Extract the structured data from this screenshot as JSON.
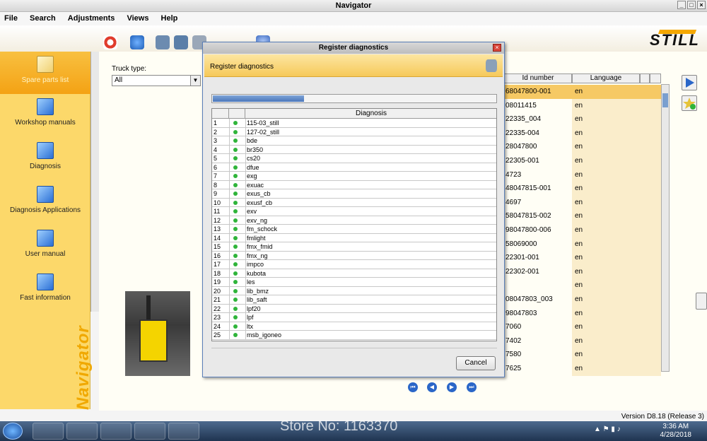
{
  "window": {
    "title": "Navigator"
  },
  "menu": [
    "File",
    "Search",
    "Adjustments",
    "Views",
    "Help"
  ],
  "logo": "STILL",
  "sidebar": {
    "items": [
      {
        "label": "Spare parts list",
        "icon": "book-icon",
        "active": true
      },
      {
        "label": "Workshop manuals",
        "icon": "book-icon",
        "active": false
      },
      {
        "label": "Diagnosis",
        "icon": "book-icon",
        "active": false
      },
      {
        "label": "Diagnosis Applications",
        "icon": "book-icon",
        "active": false
      },
      {
        "label": "User manual",
        "icon": "book-icon",
        "active": false
      },
      {
        "label": "Fast information",
        "icon": "book-icon",
        "active": false
      }
    ],
    "watermark": "Navigator"
  },
  "filter": {
    "truck_type_label": "Truck type:",
    "truck_type_value": "All"
  },
  "right_grid": {
    "columns": [
      "Id number",
      "Language"
    ],
    "rows": [
      {
        "id": "68047800-001",
        "lang": "en"
      },
      {
        "id": "08011415",
        "lang": "en"
      },
      {
        "id": "22335_004",
        "lang": "en"
      },
      {
        "id": "22335-004",
        "lang": "en"
      },
      {
        "id": "28047800",
        "lang": "en"
      },
      {
        "id": "22305-001",
        "lang": "en"
      },
      {
        "id": "4723",
        "lang": "en"
      },
      {
        "id": "48047815-001",
        "lang": "en"
      },
      {
        "id": "4697",
        "lang": "en"
      },
      {
        "id": "58047815-002",
        "lang": "en"
      },
      {
        "id": "98047800-006",
        "lang": "en"
      },
      {
        "id": "58069000",
        "lang": "en"
      },
      {
        "id": "22301-001",
        "lang": "en"
      },
      {
        "id": "22302-001",
        "lang": "en"
      },
      {
        "id": "",
        "lang": "en"
      },
      {
        "id": "08047803_003",
        "lang": "en"
      },
      {
        "id": "98047803",
        "lang": "en"
      },
      {
        "id": "7060",
        "lang": "en"
      },
      {
        "id": "7402",
        "lang": "en"
      },
      {
        "id": "7580",
        "lang": "en"
      },
      {
        "id": "7625",
        "lang": "en"
      }
    ]
  },
  "dialog": {
    "title": "Register diagnostics",
    "banner": "Register diagnostics",
    "progress": 0.32,
    "column": "Diagnosis",
    "rows": [
      {
        "n": "1",
        "name": "115-03_still"
      },
      {
        "n": "2",
        "name": "127-02_still"
      },
      {
        "n": "3",
        "name": "bde"
      },
      {
        "n": "4",
        "name": "br350"
      },
      {
        "n": "5",
        "name": "cs20"
      },
      {
        "n": "6",
        "name": "dfue"
      },
      {
        "n": "7",
        "name": "exg"
      },
      {
        "n": "8",
        "name": "exuac"
      },
      {
        "n": "9",
        "name": "exus_cb"
      },
      {
        "n": "10",
        "name": "exusf_cb"
      },
      {
        "n": "11",
        "name": "exv"
      },
      {
        "n": "12",
        "name": "exv_ng"
      },
      {
        "n": "13",
        "name": "fm_schock"
      },
      {
        "n": "14",
        "name": "fmlight"
      },
      {
        "n": "15",
        "name": "fmx_fmid"
      },
      {
        "n": "16",
        "name": "fmx_ng"
      },
      {
        "n": "17",
        "name": "impco"
      },
      {
        "n": "18",
        "name": "kubota"
      },
      {
        "n": "19",
        "name": "les"
      },
      {
        "n": "20",
        "name": "lib_bmz"
      },
      {
        "n": "21",
        "name": "lib_saft"
      },
      {
        "n": "22",
        "name": "lpf20"
      },
      {
        "n": "23",
        "name": "lpf"
      },
      {
        "n": "24",
        "name": "ltx"
      },
      {
        "n": "25",
        "name": "msb_igoneo"
      }
    ],
    "cancel": "Cancel"
  },
  "pager": [
    "first-page-icon",
    "prev-page-icon",
    "next-page-icon",
    "last-page-icon"
  ],
  "version": "Version D8.18 (Release 3)",
  "taskbar": {
    "watermark": "Store No: 1163370",
    "time": "3:36 AM",
    "date": "4/28/2018"
  }
}
